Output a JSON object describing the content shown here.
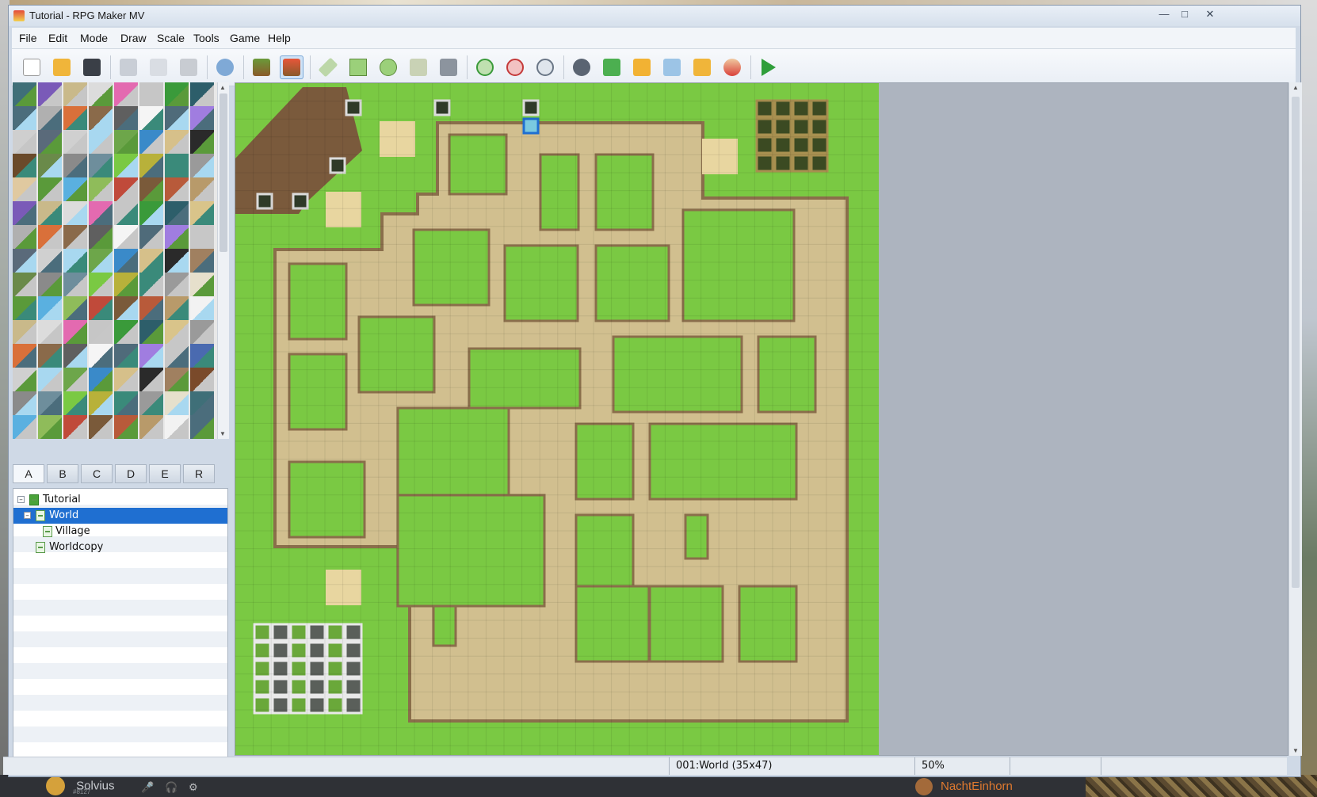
{
  "window": {
    "title": "Tutorial - RPG Maker MV",
    "controls": [
      "minimize",
      "maximize",
      "close"
    ]
  },
  "menu": [
    "File",
    "Edit",
    "Mode",
    "Draw",
    "Scale",
    "Tools",
    "Game",
    "Help"
  ],
  "toolbar": {
    "groups": [
      [
        "new-project",
        "open-project",
        "save-project"
      ],
      [
        "cut",
        "copy",
        "paste"
      ],
      [
        "undo"
      ],
      [
        "map-mode",
        "event-mode"
      ],
      [
        "pencil",
        "rectangle",
        "ellipse",
        "flood-fill",
        "shadow-pen"
      ],
      [
        "zoom-in",
        "zoom-out",
        "actual-size"
      ],
      [
        "database",
        "plugin-manager",
        "sound-test",
        "event-searcher",
        "resource-manager",
        "character-generator"
      ],
      [
        "playtest"
      ]
    ],
    "active": [
      "event-mode"
    ]
  },
  "palette_tabs": {
    "items": [
      "A",
      "B",
      "C",
      "D",
      "E",
      "R"
    ],
    "selected": "A"
  },
  "map_tree": {
    "items": [
      {
        "label": "Tutorial",
        "level": 0,
        "expanded": true,
        "type": "project"
      },
      {
        "label": "World",
        "level": 1,
        "expanded": true,
        "selected": true,
        "type": "map"
      },
      {
        "label": "Village",
        "level": 2,
        "type": "map"
      },
      {
        "label": "Worldcopy",
        "level": 1,
        "type": "map"
      }
    ]
  },
  "status": {
    "map_info": "001:World (35x47)",
    "zoom": "50%"
  },
  "taskbar": {
    "user": "Solvius",
    "user_tag": "#8127",
    "other_user": "NachtEinhorn"
  },
  "colors": {
    "grass": "#7ac943",
    "path": "#d1bf8f",
    "border": "#8a6e4b",
    "editor_bg": "#adb4bf",
    "selection": "#1f6fd1"
  }
}
